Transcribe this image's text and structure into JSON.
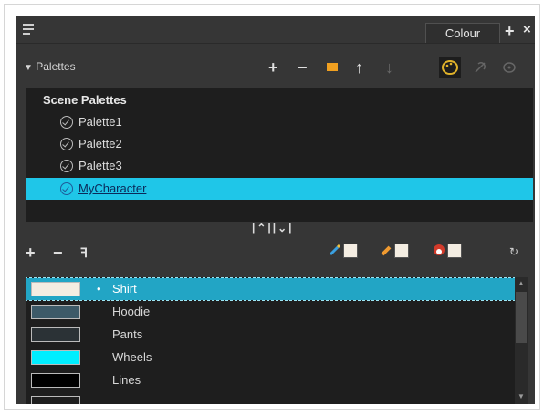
{
  "header": {
    "tab_label": "Colour",
    "add_label": "+",
    "close_label": "×"
  },
  "palettes": {
    "label": "Palettes",
    "toolbar": {
      "add": "+",
      "remove": "−",
      "up": "↑",
      "down": "↓"
    },
    "scene_header": "Scene Palettes",
    "items": [
      {
        "name": "Palette1",
        "selected": false
      },
      {
        "name": "Palette2",
        "selected": false
      },
      {
        "name": "Palette3",
        "selected": false
      },
      {
        "name": "MyCharacter",
        "selected": true
      }
    ]
  },
  "swatch_toolbar": {
    "add": "+",
    "remove": "−",
    "tint": "ꟻ"
  },
  "colors": [
    {
      "name": "Shirt",
      "hex": "#f4ede2",
      "selected": true,
      "marker": "•"
    },
    {
      "name": "Hoodie",
      "hex": "#3d5a68",
      "selected": false
    },
    {
      "name": "Pants",
      "hex": "#2b3236",
      "selected": false
    },
    {
      "name": "Wheels",
      "hex": "#00eeff",
      "selected": false
    },
    {
      "name": "Lines",
      "hex": "#000000",
      "selected": false
    }
  ],
  "accent": "#1fc6e8"
}
